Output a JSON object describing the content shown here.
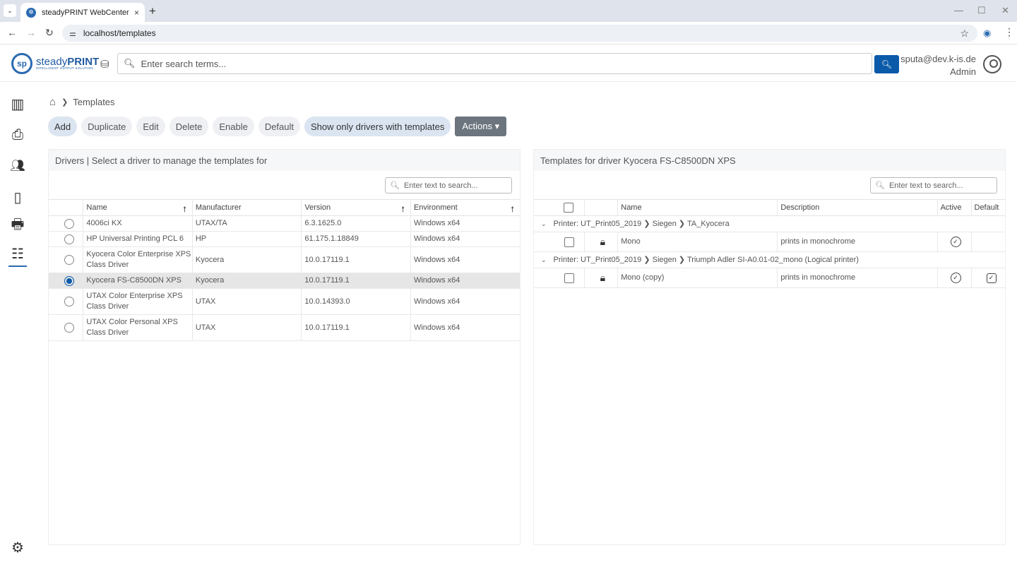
{
  "browser": {
    "tab_title": "steadyPRINT WebCenter",
    "url": "localhost/templates",
    "new_tab": "+",
    "close_tab": "×"
  },
  "header": {
    "brand_name": "steady",
    "brand_bold": "PRINT",
    "brand_tagline": "INTELLIGENT OUTPUT SOLUTION",
    "search_placeholder": "Enter search terms...",
    "user_email": "sputa@dev.k-is.de",
    "user_role": "Admin"
  },
  "sidebar": {
    "items": [
      {
        "name": "dashboard-icon",
        "glyph": "▥"
      },
      {
        "name": "printer-icon",
        "glyph": "⎙"
      },
      {
        "name": "users-icon",
        "glyph": "👥"
      },
      {
        "name": "mobile-icon",
        "glyph": "▯"
      },
      {
        "name": "printer-alt-icon",
        "glyph": "🖶"
      },
      {
        "name": "templates-icon",
        "glyph": "☰"
      },
      {
        "name": "settings-icon",
        "glyph": "⚙"
      }
    ]
  },
  "breadcrumb": {
    "current": "Templates"
  },
  "toolbar": {
    "add": "Add",
    "duplicate": "Duplicate",
    "edit": "Edit",
    "delete": "Delete",
    "enable": "Enable",
    "default": "Default",
    "show_only": "Show only drivers with templates",
    "actions": "Actions ▾"
  },
  "drivers": {
    "title": "Drivers | Select a driver to manage the templates for",
    "search_placeholder": "Enter text to search...",
    "columns": [
      "Name",
      "Manufacturer",
      "Version",
      "Environment"
    ],
    "rows": [
      {
        "name": "4006ci KX",
        "manufacturer": "UTAX/TA",
        "version": "6.3.1625.0",
        "environment": "Windows x64",
        "selected": false
      },
      {
        "name": "HP Universal Printing PCL 6",
        "manufacturer": "HP",
        "version": "61.175.1.18849",
        "environment": "Windows x64",
        "selected": false
      },
      {
        "name": "Kyocera Color Enterprise XPS Class Driver",
        "manufacturer": "Kyocera",
        "version": "10.0.17119.1",
        "environment": "Windows x64",
        "selected": false
      },
      {
        "name": "Kyocera FS-C8500DN XPS",
        "manufacturer": "Kyocera",
        "version": "10.0.17119.1",
        "environment": "Windows x64",
        "selected": true
      },
      {
        "name": "UTAX Color Enterprise XPS Class Driver",
        "manufacturer": "UTAX",
        "version": "10.0.14393.0",
        "environment": "Windows x64",
        "selected": false
      },
      {
        "name": "UTAX Color Personal XPS Class Driver",
        "manufacturer": "UTAX",
        "version": "10.0.17119.1",
        "environment": "Windows x64",
        "selected": false
      }
    ]
  },
  "templates": {
    "title": "Templates for driver Kyocera FS-C8500DN XPS",
    "search_placeholder": "Enter text to search...",
    "columns": [
      "Name",
      "Description",
      "Active",
      "Default"
    ],
    "groups": [
      {
        "label": "Printer: UT_Print05_2019 ❯ Siegen ❯ TA_Kyocera",
        "rows": [
          {
            "name": "Mono",
            "description": "prints in monochrome",
            "active": true,
            "default": false
          }
        ]
      },
      {
        "label": "Printer: UT_Print05_2019 ❯ Siegen ❯ Triumph Adler SI-A0.01-02_mono (Logical printer)",
        "rows": [
          {
            "name": "Mono (copy)",
            "description": "prints in monochrome",
            "active": true,
            "default": true
          }
        ]
      }
    ]
  }
}
